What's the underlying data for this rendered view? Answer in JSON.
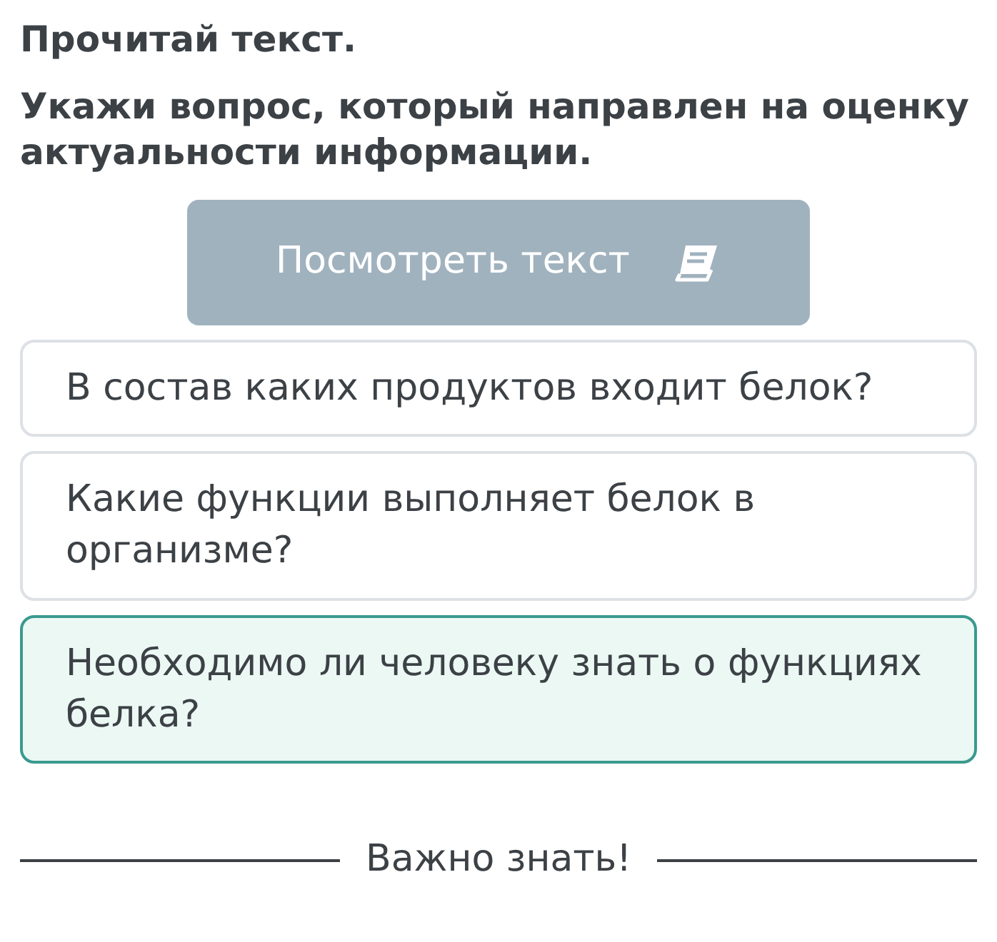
{
  "instruction": "Прочитай текст.",
  "question": "Укажи вопрос, который направлен на оценку актуальности информации.",
  "view_button": {
    "label": "Посмотреть текст",
    "disabled": true
  },
  "options": [
    {
      "text": "В состав каких продуктов входит белок?",
      "selected": false
    },
    {
      "text": "Какие функции выполняет белок в организме?",
      "selected": false
    },
    {
      "text": "Необходимо ли человеку знать о функциях белка?",
      "selected": true
    }
  ],
  "divider_label": "Важно знать!"
}
